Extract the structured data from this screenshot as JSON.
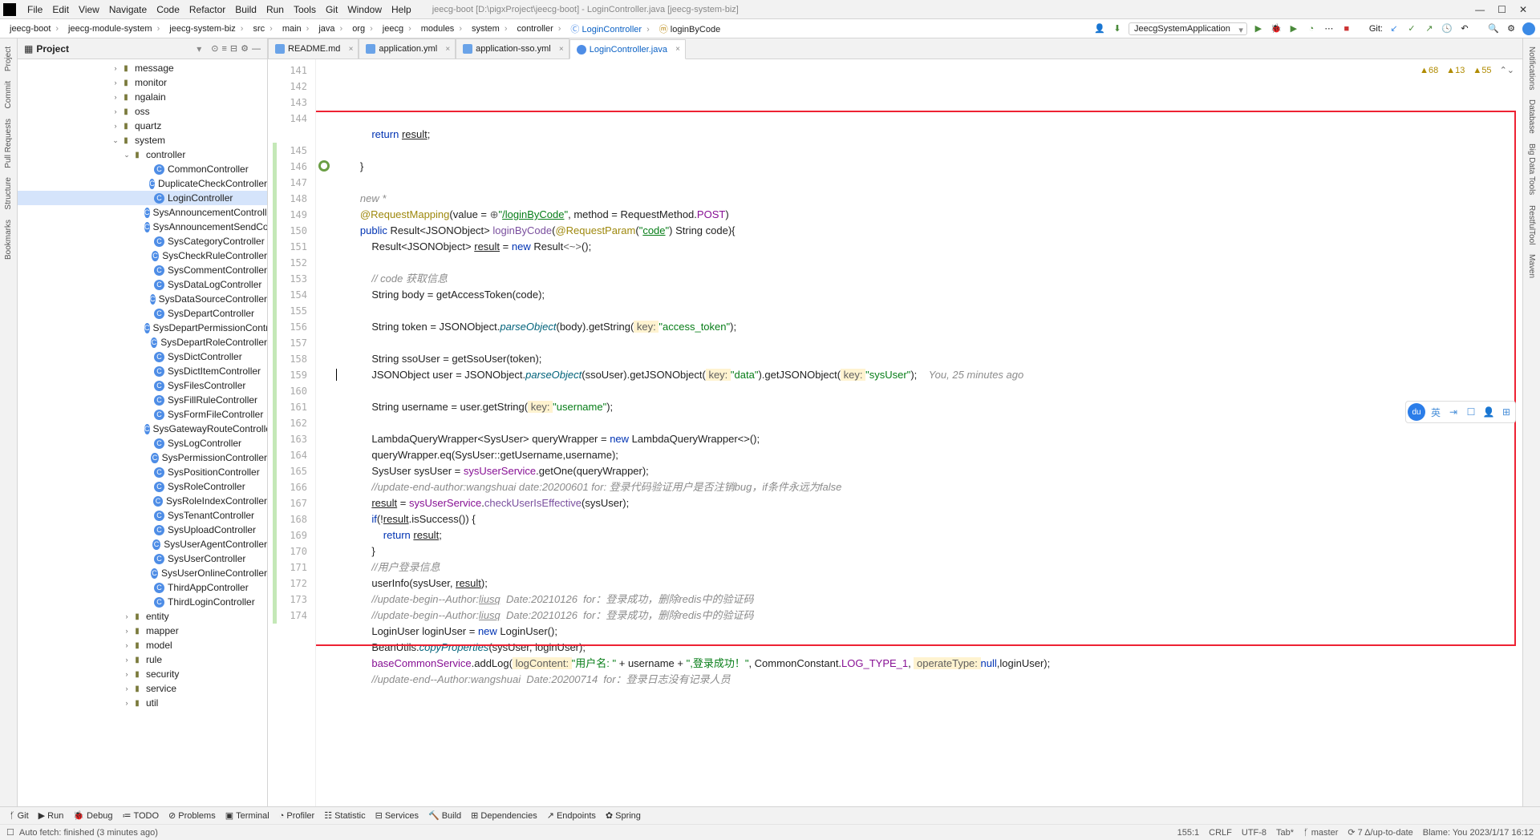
{
  "window": {
    "title": "jeecg-boot [D:\\pigxProject\\jeecg-boot] - LoginController.java [jeecg-system-biz]"
  },
  "menu": [
    "File",
    "Edit",
    "View",
    "Navigate",
    "Code",
    "Refactor",
    "Build",
    "Run",
    "Tools",
    "Git",
    "Window",
    "Help"
  ],
  "breadcrumb": {
    "segs": [
      "jeecg-boot",
      "jeecg-module-system",
      "jeecg-system-biz",
      "src",
      "main",
      "java",
      "org",
      "jeecg",
      "modules",
      "system",
      "controller",
      "LoginController",
      "loginByCode"
    ]
  },
  "toolbar": {
    "run_config": "JeecgSystemApplication",
    "git_label": "Git:"
  },
  "project": {
    "header": "Project",
    "folders_top": [
      "message",
      "monitor",
      "ngalain",
      "oss",
      "quartz"
    ],
    "system_label": "system",
    "controller_label": "controller",
    "controllers": [
      "CommonController",
      "DuplicateCheckController",
      "LoginController",
      "SysAnnouncementController",
      "SysAnnouncementSendController",
      "SysCategoryController",
      "SysCheckRuleController",
      "SysCommentController",
      "SysDataLogController",
      "SysDataSourceController",
      "SysDepartController",
      "SysDepartPermissionController",
      "SysDepartRoleController",
      "SysDictController",
      "SysDictItemController",
      "SysFilesController",
      "SysFillRuleController",
      "SysFormFileController",
      "SysGatewayRouteController",
      "SysLogController",
      "SysPermissionController",
      "SysPositionController",
      "SysRoleController",
      "SysRoleIndexController",
      "SysTenantController",
      "SysUploadController",
      "SysUserAgentController",
      "SysUserController",
      "SysUserOnlineController",
      "ThirdAppController",
      "ThirdLoginController"
    ],
    "selected_controller": "LoginController",
    "folders_bottom": [
      "entity",
      "mapper",
      "model",
      "rule",
      "security",
      "service",
      "util"
    ]
  },
  "tabs": [
    {
      "name": "README.md",
      "icon": "md"
    },
    {
      "name": "application.yml",
      "icon": "yml"
    },
    {
      "name": "application-sso.yml",
      "icon": "yml"
    },
    {
      "name": "LoginController.java",
      "icon": "java",
      "active": true,
      "blue": true
    }
  ],
  "inspections": {
    "warn68": "68",
    "warn13": "13",
    "warn55": "55"
  },
  "gutter_start": 141,
  "code_lines": [
    {
      "n": 141,
      "html": "            <span class='kw'>return</span> <span class='und'>result</span>;"
    },
    {
      "n": 142,
      "html": ""
    },
    {
      "n": 143,
      "html": "        }"
    },
    {
      "n": 144,
      "html": ""
    },
    {
      "n": 0,
      "html": "        <span class='cm'>new *</span>"
    },
    {
      "n": 145,
      "html": "        <span class='ann'>@RequestMapping</span>(value = <span class='param'>⊕</span><span class='str'>\"<span class='und'>/loginByCode</span>\"</span>, method = RequestMethod.<span class='fi'>POST</span>)",
      "green": true
    },
    {
      "n": 146,
      "html": "        <span class='kw'>public</span> Result&lt;JSONObject&gt; <span class='fn'>loginByCode</span>(<span class='ann'>@RequestParam</span>(<span class='str'>\"<span class='und'>code</span>\"</span>) String code){",
      "green": true,
      "micon": true
    },
    {
      "n": 147,
      "html": "            Result&lt;JSONObject&gt; <span class='und'>result</span> = <span class='kw'>new</span> Result<span class='param'>&lt;~&gt;</span>();",
      "green": true
    },
    {
      "n": 148,
      "html": "",
      "green": true
    },
    {
      "n": 149,
      "html": "            <span class='cm'>// code 获取信息</span>",
      "green": true
    },
    {
      "n": 150,
      "html": "            String body = getAccessToken(code);",
      "green": true
    },
    {
      "n": 151,
      "html": "",
      "green": true
    },
    {
      "n": 152,
      "html": "            String token = JSONObject.<span class='fnit'>parseObject</span>(body).getString(<span class='hl'><span class='param'> key: </span></span><span class='str'>\"access_token\"</span>);",
      "green": true
    },
    {
      "n": 153,
      "html": "",
      "green": true
    },
    {
      "n": 154,
      "html": "            String ssoUser = getSsoUser(token);",
      "green": true
    },
    {
      "n": 155,
      "html": "            JSONObject user = JSONObject.<span class='fnit'>parseObject</span>(ssoUser).getJSONObject(<span class='hl'><span class='param'> key: </span></span><span class='str'>\"data\"</span>).getJSONObject(<span class='hl'><span class='param'> key: </span></span><span class='str'>\"sysUser\"</span>);    <span class='cm'>You, 25 minutes ago</span>",
      "green": true,
      "caret": true
    },
    {
      "n": 156,
      "html": "",
      "green": true
    },
    {
      "n": 157,
      "html": "            String username = user.getString(<span class='hl'><span class='param'> key: </span></span><span class='str'>\"username\"</span>);",
      "green": true
    },
    {
      "n": 158,
      "html": "",
      "green": true
    },
    {
      "n": 159,
      "html": "            LambdaQueryWrapper&lt;SysUser&gt; queryWrapper = <span class='kw'>new</span> LambdaQueryWrapper&lt;&gt;();",
      "green": true
    },
    {
      "n": 160,
      "html": "            queryWrapper.eq(SysUser::getUsername,username);",
      "green": true
    },
    {
      "n": 161,
      "html": "            SysUser sysUser = <span class='fi'>sysUserService</span>.getOne(queryWrapper);",
      "green": true
    },
    {
      "n": 162,
      "html": "            <span class='cm'>//update-end-author:wangshuai date:20200601 for: 登录代码验证用户是否注销bug，if条件永远为false</span>",
      "green": true
    },
    {
      "n": 163,
      "html": "            <span class='und'>result</span> = <span class='fi'>sysUserService</span>.<span class='fn'>checkUserIsEffective</span>(sysUser);",
      "green": true
    },
    {
      "n": 164,
      "html": "            <span class='kw'>if</span>(!<span class='und'>result</span>.isSuccess()) {",
      "green": true
    },
    {
      "n": 165,
      "html": "                <span class='kw'>return</span> <span class='und'>result</span>;",
      "green": true
    },
    {
      "n": 166,
      "html": "            }",
      "green": true
    },
    {
      "n": 167,
      "html": "            <span class='cm'>//用户登录信息</span>",
      "green": true
    },
    {
      "n": 168,
      "html": "            userInfo(sysUser, <span class='und'>result</span>);",
      "green": true
    },
    {
      "n": 169,
      "html": "            <span class='cm'>//update-begin--Author:<span class='und'>liusq</span>  Date:20210126  for：登录成功，删除redis中的验证码</span>",
      "green": true
    },
    {
      "n": 170,
      "html": "            <span class='cm'>//update-begin--Author:<span class='und'>liusq</span>  Date:20210126  for：登录成功，删除redis中的验证码</span>",
      "green": true
    },
    {
      "n": 171,
      "html": "            LoginUser loginUser = <span class='kw'>new</span> LoginUser();",
      "green": true
    },
    {
      "n": 172,
      "html": "            BeanUtils.<span class='fnit'>copyProperties</span>(sysUser, loginUser);",
      "green": true
    },
    {
      "n": 173,
      "html": "            <span class='fi'>baseCommonService</span>.addLog(<span class='hl'><span class='param'> logContent: </span></span><span class='str'>\"用户名: \"</span> + username + <span class='str'>\",登录成功！\"</span>, CommonConstant.<span class='fi'>LOG_TYPE_1</span>, <span class='hl'><span class='param'> operateType: </span></span><span class='kw'>null</span>,loginUser);",
      "green": true
    },
    {
      "n": 174,
      "html": "            <span class='cm'>//update-end--Author:wangshuai  Date:20200714  for：登录日志没有记录人员</span>",
      "green": true
    }
  ],
  "bottom_tools": [
    "Git",
    "Run",
    "Debug",
    "TODO",
    "Problems",
    "Terminal",
    "Profiler",
    "Statistic",
    "Services",
    "Build",
    "Dependencies",
    "Endpoints",
    "Spring"
  ],
  "status": {
    "left": "Auto fetch: finished (3 minutes ago)",
    "pos": "155:1",
    "enc": "CRLF",
    "charset": "UTF-8",
    "tab": "Tab*",
    "branch": "master",
    "uptodate": "7 Δ/up-to-date",
    "blame": "Blame: You 2023/1/17 16:12"
  },
  "left_rail": [
    "Project",
    "Commit",
    "Pull Requests",
    "Structure",
    "Bookmarks"
  ],
  "right_rail": [
    "Notifications",
    "Database",
    "Big Data Tools",
    "RestfulTool",
    "Maven"
  ]
}
